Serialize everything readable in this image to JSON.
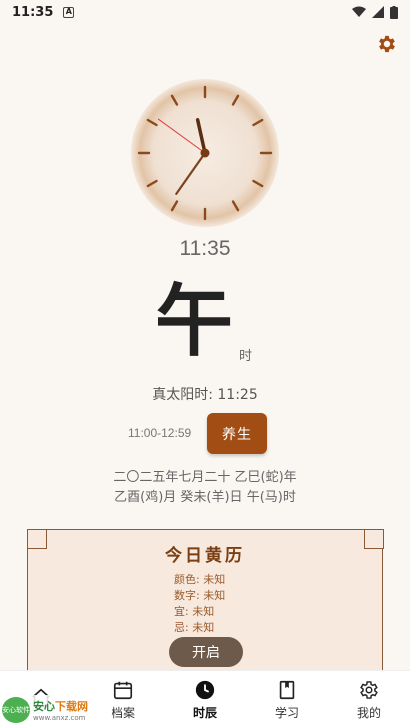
{
  "status": {
    "time": "11:35",
    "notif": "A"
  },
  "clock": {
    "hour": 11,
    "minute": 35,
    "second": 51
  },
  "digital_time": "11:35",
  "shichen": {
    "char": "午",
    "suffix": "时"
  },
  "solar_time": "真太阳时: 11:25",
  "time_range": "11:00-12:59",
  "health_button": "养生",
  "lunar": {
    "line1": "二〇二五年七月二十 乙巳(蛇)年",
    "line2": "乙酉(鸡)月 癸未(羊)日 午(马)时"
  },
  "almanac": {
    "title": "今日黄历",
    "lines": [
      "颜色: 未知",
      "数字: 未知",
      "宜: 未知",
      "忌: 未知"
    ],
    "button": "开启"
  },
  "nav": [
    {
      "label": "",
      "icon": "home-icon"
    },
    {
      "label": "档案",
      "icon": "calendar-icon"
    },
    {
      "label": "时辰",
      "icon": "clock-icon"
    },
    {
      "label": "学习",
      "icon": "book-icon"
    },
    {
      "label": "我的",
      "icon": "gear-icon"
    }
  ],
  "watermark": {
    "logo": "安心软件",
    "main_a": "安心",
    "main_b": "下载网",
    "sub": "www.anxz.com"
  },
  "colors": {
    "accent": "#a24d14",
    "card_bg": "#f8e9de",
    "card_border": "#8a5a36"
  }
}
